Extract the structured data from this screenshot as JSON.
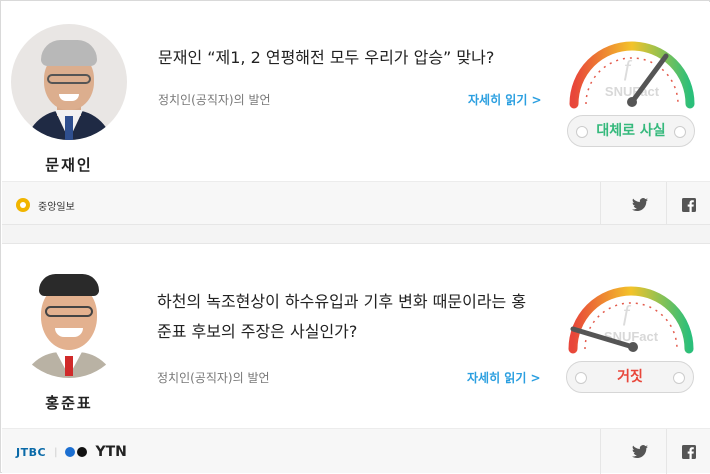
{
  "items": [
    {
      "person_name": "문재인",
      "claim": "문재인 “제1, 2 연평해전 모두 우리가 압승” 맞나?",
      "speaker_type": "정치인(공직자)의 발언",
      "more_link": "자세히 읽기 >",
      "gauge_brand": "SNUFact",
      "verdict": "대체로 사실",
      "verdict_color": "#35b97c",
      "sources": [
        "중앙일보"
      ]
    },
    {
      "person_name": "홍준표",
      "claim_line1": "하천의 녹조현상이 하수유입과 기후 변화 때문이라는 홍",
      "claim_line2": "준표 후보의 주장은 사실인가?",
      "speaker_type": "정치인(공직자)의 발언",
      "more_link": "자세히 읽기 >",
      "gauge_brand": "SNUFact",
      "verdict": "거짓",
      "verdict_color": "#e8463a",
      "sources": [
        "JTBC",
        "YTN"
      ]
    }
  ],
  "icons": {
    "share": [
      "twitter-icon",
      "facebook-icon"
    ]
  },
  "colors": {
    "link": "#2b9fe0",
    "gauge_red": "#e8463a",
    "gauge_yellow": "#f3c32a",
    "gauge_green": "#2bbf7a"
  }
}
